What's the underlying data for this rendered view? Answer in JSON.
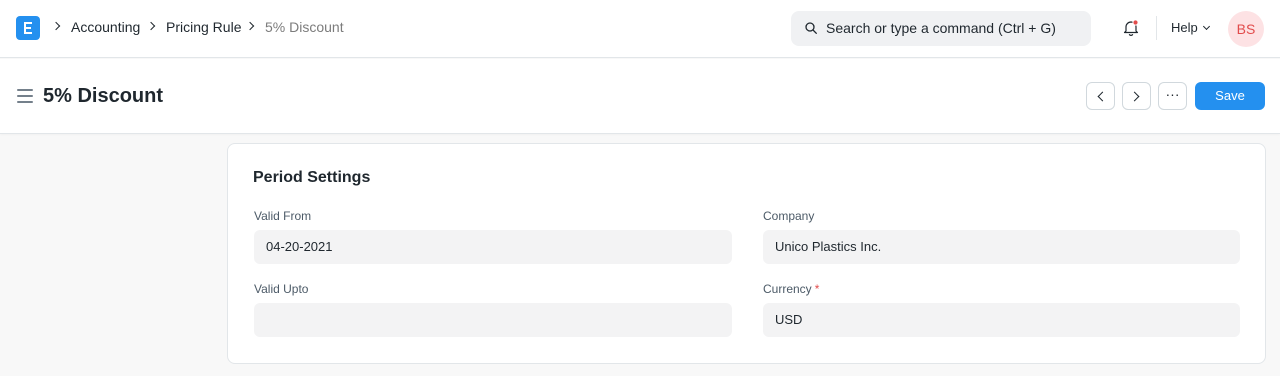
{
  "navbar": {
    "breadcrumbs": [
      "Accounting",
      "Pricing Rule",
      "5% Discount"
    ],
    "search_placeholder": "Search or type a command (Ctrl + G)",
    "help_label": "Help",
    "avatar_initials": "BS"
  },
  "page_head": {
    "title": "5% Discount",
    "more_label": "···",
    "save_label": "Save"
  },
  "form": {
    "section_title": "Period Settings",
    "fields": [
      {
        "label": "Valid From",
        "value": "04-20-2021",
        "required": false
      },
      {
        "label": "Valid Upto",
        "value": "",
        "required": false
      },
      {
        "label": "Company",
        "value": "Unico Plastics Inc.",
        "required": false
      },
      {
        "label": "Currency",
        "value": "USD",
        "required": true,
        "required_mark": "*"
      }
    ]
  },
  "colors": {
    "primary": "#2490ef",
    "avatar_bg": "#fde2e4",
    "avatar_text": "#e24c4c",
    "required_mark": "#e24c4c"
  },
  "icons": [
    "app-logo-icon",
    "chevron-right-icon",
    "search-icon",
    "bell-icon",
    "chevron-down-icon",
    "hamburger-menu-icon",
    "chevron-left-icon",
    "more-horizontal-icon"
  ]
}
